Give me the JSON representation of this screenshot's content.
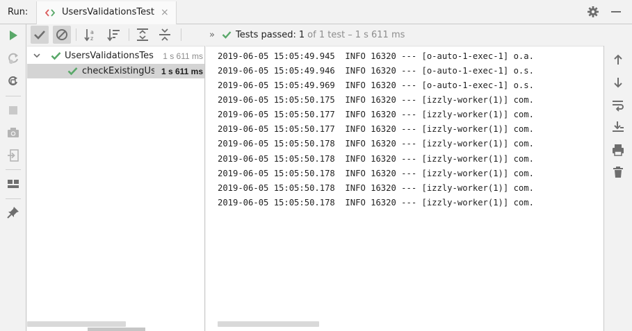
{
  "window": {
    "run_label": "Run:",
    "tab_title": "UsersValidationsTest",
    "tab_close": "×"
  },
  "toolbar": {
    "status": {
      "chevron": "»",
      "passed_label": "Tests passed:",
      "passed_count": "1",
      "of_total": "of 1 test",
      "dash": "–",
      "duration": "1 s 611 ms"
    }
  },
  "tree": {
    "items": [
      {
        "name": "UsersValidationsTest",
        "time": "1 s 611 ms",
        "expanded": true,
        "level": 0
      },
      {
        "name": "checkExistingUsers",
        "time": "1 s 611 ms",
        "selected": true,
        "level": 1
      }
    ]
  },
  "console": {
    "lines": [
      "2019-06-05 15:05:49.945  INFO 16320 --- [o-auto-1-exec-1] o.a.",
      "2019-06-05 15:05:49.946  INFO 16320 --- [o-auto-1-exec-1] o.s.",
      "2019-06-05 15:05:49.969  INFO 16320 --- [o-auto-1-exec-1] o.s.",
      "2019-06-05 15:05:50.175  INFO 16320 --- [izzly-worker(1)] com.",
      "2019-06-05 15:05:50.177  INFO 16320 --- [izzly-worker(1)] com.",
      "2019-06-05 15:05:50.177  INFO 16320 --- [izzly-worker(1)] com.",
      "2019-06-05 15:05:50.178  INFO 16320 --- [izzly-worker(1)] com.",
      "2019-06-05 15:05:50.178  INFO 16320 --- [izzly-worker(1)] com.",
      "2019-06-05 15:05:50.178  INFO 16320 --- [izzly-worker(1)] com.",
      "2019-06-05 15:05:50.178  INFO 16320 --- [izzly-worker(1)] com.",
      "2019-06-05 15:05:50.178  INFO 16320 --- [izzly-worker(1)] com."
    ]
  },
  "colors": {
    "pass_green": "#59a869",
    "run_green": "#59a869",
    "icon_gray": "#6e6e6e",
    "disabled_gray": "#b5b5b5",
    "tab_icon_red": "#db5c5c",
    "tab_icon_green": "#59a869"
  },
  "icons": {
    "tab": "test-run-icon",
    "gear": "gear-icon",
    "minimize": "minimize-icon",
    "left_strip": [
      "rerun-icon",
      "rerun-failed-icon",
      "toggle-auto-test-icon",
      "stop-icon",
      "camera-icon",
      "export-icon",
      "layout-icon",
      "pin-icon"
    ],
    "test_toolbar": [
      "show-passed-icon",
      "show-ignored-icon",
      "sort-alpha-icon",
      "sort-duration-icon",
      "expand-all-icon",
      "collapse-all-icon"
    ],
    "right_strip": [
      "scroll-up-icon",
      "scroll-down-icon",
      "soft-wrap-icon",
      "scroll-to-end-icon",
      "print-icon",
      "clear-icon"
    ]
  }
}
